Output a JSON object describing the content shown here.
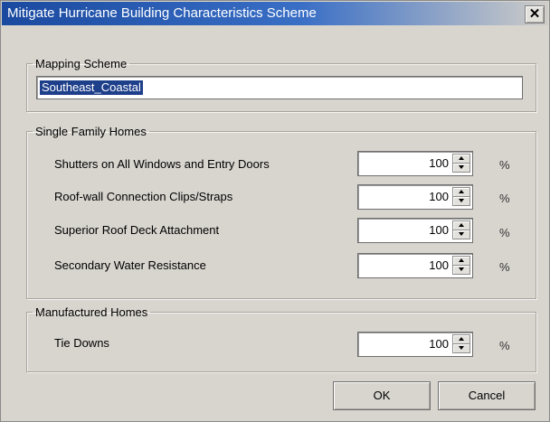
{
  "window": {
    "title": "Mitigate Hurricane Building Characteristics Scheme",
    "close_glyph": "✕"
  },
  "mapping_scheme": {
    "legend": "Mapping Scheme",
    "value": "Southeast_Coastal"
  },
  "single_family": {
    "legend": "Single Family Homes",
    "rows": [
      {
        "label": "Shutters on All Windows and Entry Doors",
        "value": "100",
        "unit": "%"
      },
      {
        "label": "Roof-wall Connection Clips/Straps",
        "value": "100",
        "unit": "%"
      },
      {
        "label": "Superior Roof Deck Attachment",
        "value": "100",
        "unit": "%"
      },
      {
        "label": "Secondary Water Resistance",
        "value": "100",
        "unit": "%"
      }
    ]
  },
  "manufactured": {
    "legend": "Manufactured Homes",
    "rows": [
      {
        "label": "Tie Downs",
        "value": "100",
        "unit": "%"
      }
    ]
  },
  "buttons": {
    "ok": "OK",
    "cancel": "Cancel"
  },
  "icons": {
    "close": "close-icon",
    "spin_up": "arrow-up-icon",
    "spin_down": "arrow-down-icon"
  }
}
